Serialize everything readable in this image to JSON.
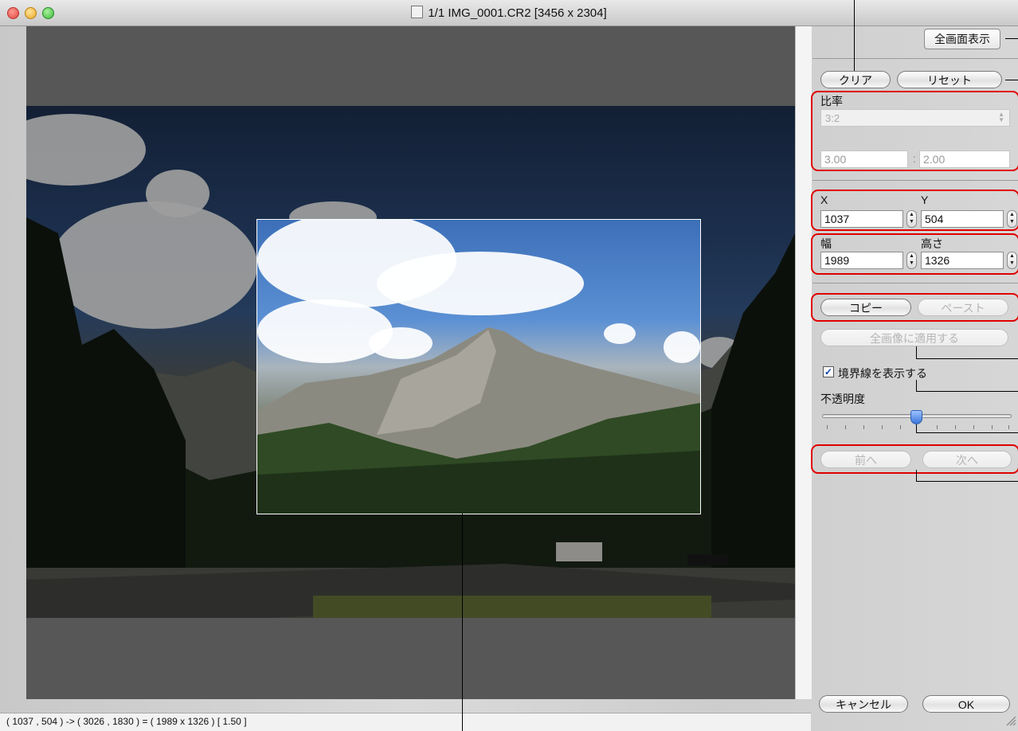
{
  "window": {
    "title": "1/1 IMG_0001.CR2 [3456 x 2304]",
    "status": "( 1037 , 504 ) -> ( 3026 , 1830 ) = ( 1989 x 1326 ) [ 1.50 ]"
  },
  "toolbar": {
    "fullscreen_label": "全画面表示",
    "clear_label": "クリア",
    "reset_label": "リセット"
  },
  "ratio": {
    "label": "比率",
    "selected": "3:2",
    "width_value": "3.00",
    "separator": ":",
    "height_value": "2.00"
  },
  "position": {
    "x_label": "X",
    "y_label": "Y",
    "x_value": "1037",
    "y_value": "504"
  },
  "size": {
    "width_label": "幅",
    "height_label": "高さ",
    "width_value": "1989",
    "height_value": "1326"
  },
  "clipboard": {
    "copy_label": "コピー",
    "paste_label": "ペースト",
    "apply_all_label": "全画像に適用する"
  },
  "border": {
    "checkbox_label": "境界線を表示する",
    "checked": true,
    "opacity_label": "不透明度",
    "opacity_value": 0.5
  },
  "navigation": {
    "prev_label": "前へ",
    "next_label": "次へ"
  },
  "footer": {
    "cancel_label": "キャンセル",
    "ok_label": "OK"
  },
  "icons": {
    "close": "close-light-icon",
    "minimize": "minimize-light-icon",
    "zoom": "zoom-light-icon",
    "document": "document-icon",
    "stepper": "stepper-arrows-icon",
    "checkmark": "checkmark-icon",
    "resize": "resize-grip-icon"
  },
  "colors": {
    "close": "#ff5f57",
    "minimize": "#ffbd2e",
    "zoom": "#28c840",
    "highlight": "#e00000",
    "slider_thumb": "#3a74d8"
  }
}
